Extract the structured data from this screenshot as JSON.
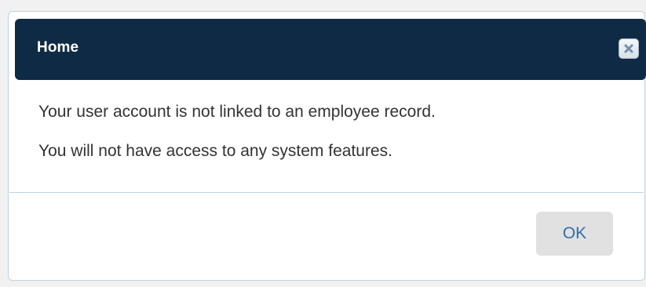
{
  "dialog": {
    "title": "Home",
    "messages": [
      "Your user account is not linked to an employee record.",
      "You will not have access to any system features."
    ],
    "ok_label": "OK",
    "close_icon": "close-icon"
  },
  "colors": {
    "titlebar_bg": "#0f2a44",
    "title_text": "#ffffff",
    "body_text": "#333333",
    "divider": "#bcd3e3",
    "ok_bg": "#e1e1e1",
    "ok_text": "#2f6fae"
  }
}
